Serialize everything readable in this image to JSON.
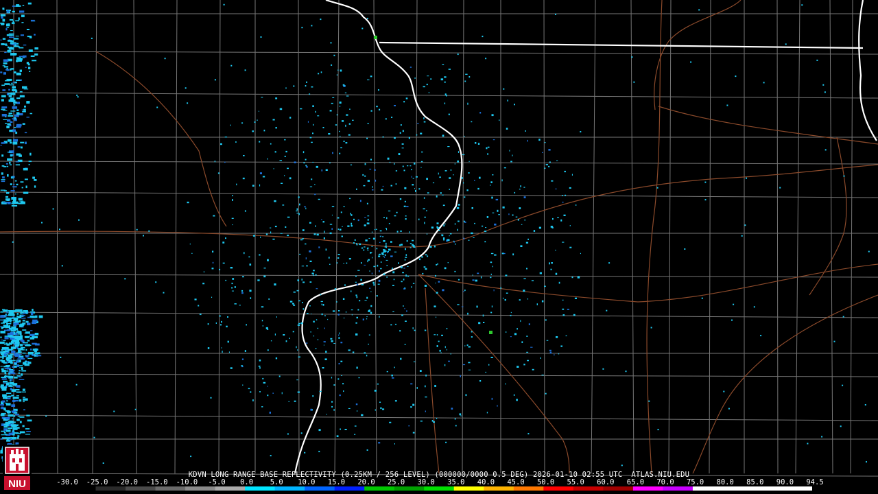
{
  "product_caption": "KDVN LONG RANGE BASE REFLECTIVITY (0.25KM / 256 LEVEL) (000000/0000 0.5 DEG) 2026-01-10 02:55 UTC  ATLAS.NIU.EDU",
  "colorbar": {
    "labels": [
      "-30.0",
      "-25.0",
      "-20.0",
      "-15.0",
      "-10.0",
      "-5.0",
      "0.0",
      "5.0",
      "10.0",
      "15.0",
      "20.0",
      "25.0",
      "30.0",
      "35.0",
      "40.0",
      "45.0",
      "50.0",
      "55.0",
      "60.0",
      "65.0",
      "70.0",
      "75.0",
      "80.0",
      "85.0",
      "90.0",
      "94.5"
    ],
    "stops": [
      "#000000",
      "#2a2a2a",
      "#4a4a4a",
      "#6a6a6a",
      "#8a8a8a",
      "#aaaaaa",
      "#00e5ff",
      "#00b4ff",
      "#0064ff",
      "#0020ff",
      "#00c800",
      "#00a000",
      "#00e000",
      "#ffff00",
      "#ffb400",
      "#ff7800",
      "#ff0000",
      "#c80000",
      "#a00000",
      "#ff00ff",
      "#c800ff",
      "#ffffff",
      "#ffffff",
      "#ffffff",
      "#ffffff"
    ]
  },
  "logo": {
    "text": "NIU",
    "color": "#c8102e"
  },
  "colors": {
    "county_lines": "#7a7a7a",
    "state_lines": "#ffffff",
    "highways": "#8b4a2b",
    "echo": "#1ec8f0",
    "echo_dark": "#1c6fd8"
  }
}
